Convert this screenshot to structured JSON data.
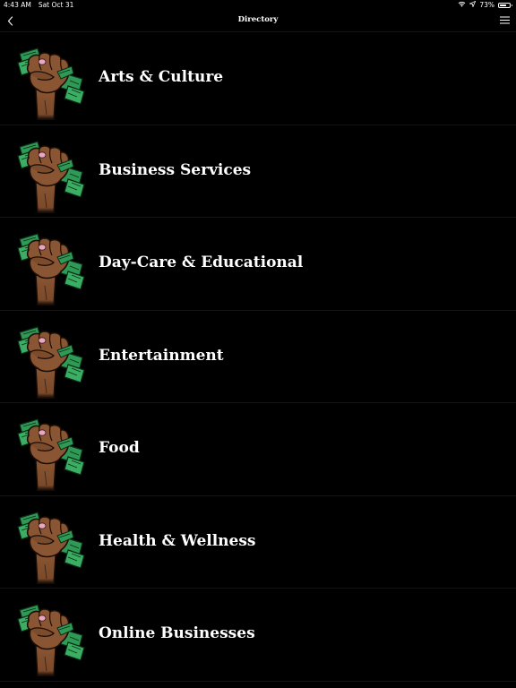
{
  "status_bar": {
    "time": "4:43 AM",
    "date": "Sat Oct 31",
    "battery": "73%",
    "battery_level": 0.73
  },
  "nav": {
    "title": "Directory",
    "back_icon": "chevron-left-icon",
    "menu_icon": "hamburger-menu-icon"
  },
  "categories": [
    {
      "label": "Arts & Culture",
      "icon": "fist-with-money-icon"
    },
    {
      "label": "Business Services",
      "icon": "fist-with-money-icon"
    },
    {
      "label": "Day-Care & Educational",
      "icon": "fist-with-money-icon"
    },
    {
      "label": "Entertainment",
      "icon": "fist-with-money-icon"
    },
    {
      "label": "Food",
      "icon": "fist-with-money-icon"
    },
    {
      "label": "Health & Wellness",
      "icon": "fist-with-money-icon"
    },
    {
      "label": "Online Businesses",
      "icon": "fist-with-money-icon"
    }
  ],
  "colors": {
    "background": "#000000",
    "skin": "#8a5532",
    "money": "#2e9a55",
    "accent_pink": "#e8a8c0"
  }
}
